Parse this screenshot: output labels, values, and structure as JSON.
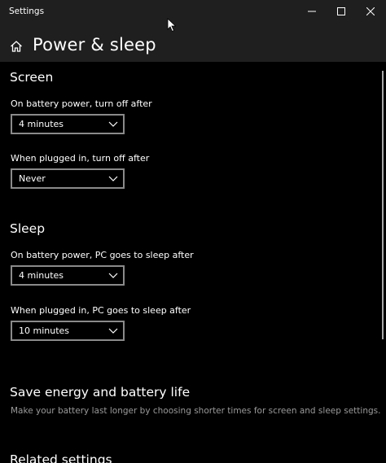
{
  "window": {
    "title": "Settings",
    "controls": {
      "minimize_icon": "minimize-icon",
      "maximize_icon": "maximize-icon",
      "close_icon": "close-icon"
    }
  },
  "header": {
    "home_icon": "home-icon",
    "title": "Power & sleep"
  },
  "screen": {
    "title": "Screen",
    "battery": {
      "label": "On battery power, turn off after",
      "value": "4 minutes"
    },
    "plugged": {
      "label": "When plugged in, turn off after",
      "value": "Never"
    }
  },
  "sleep": {
    "title": "Sleep",
    "battery": {
      "label": "On battery power, PC goes to sleep after",
      "value": "4 minutes"
    },
    "plugged": {
      "label": "When plugged in, PC goes to sleep after",
      "value": "10 minutes"
    }
  },
  "energy": {
    "title": "Save energy and battery life",
    "description": "Make your battery last longer by choosing shorter times for screen and sleep settings."
  },
  "related": {
    "title": "Related settings"
  },
  "colors": {
    "background": "#000000",
    "titlebar": "#1f1f1f",
    "text": "#ffffff",
    "secondary_text": "#9a9a9a",
    "dropdown_border": "#8a8a8a"
  }
}
